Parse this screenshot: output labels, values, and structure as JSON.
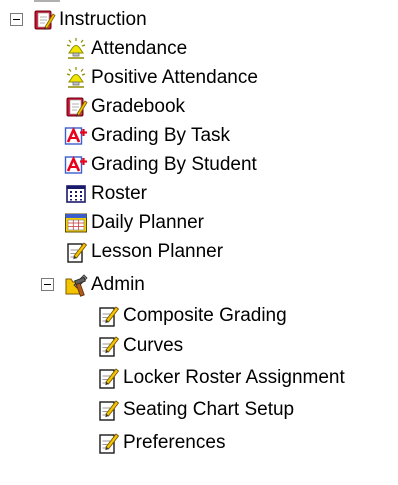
{
  "tree": {
    "root": {
      "label": "Instruction",
      "icon": "gradebook-icon",
      "expanded": true
    },
    "items": [
      {
        "label": "Attendance",
        "icon": "attendance-bulb-icon"
      },
      {
        "label": "Positive Attendance",
        "icon": "attendance-bulb-icon"
      },
      {
        "label": "Gradebook",
        "icon": "gradebook-icon"
      },
      {
        "label": "Grading By Task",
        "icon": "grade-a-plus-icon"
      },
      {
        "label": "Grading By Student",
        "icon": "grade-a-plus-icon"
      },
      {
        "label": "Roster",
        "icon": "roster-table-icon"
      },
      {
        "label": "Daily Planner",
        "icon": "calendar-icon"
      },
      {
        "label": "Lesson Planner",
        "icon": "notepad-pencil-icon"
      }
    ],
    "admin": {
      "label": "Admin",
      "icon": "admin-tools-icon",
      "expanded": true,
      "items": [
        {
          "label": "Composite Grading",
          "icon": "notepad-pencil-icon"
        },
        {
          "label": "Curves",
          "icon": "notepad-pencil-icon"
        },
        {
          "label": "Locker Roster Assignment",
          "icon": "notepad-pencil-icon"
        },
        {
          "label": "Seating Chart Setup",
          "icon": "notepad-pencil-icon"
        },
        {
          "label": "Preferences",
          "icon": "notepad-pencil-icon"
        }
      ]
    }
  },
  "colors": {
    "bulb_yellow": "#f2e600",
    "bulb_outline": "#8c8c00",
    "grade_red": "#e8001c",
    "book_red": "#c8102e",
    "calendar_blue": "#3a5fcd",
    "calendar_yellow": "#f4d000",
    "tools_brown": "#b35a1f"
  }
}
